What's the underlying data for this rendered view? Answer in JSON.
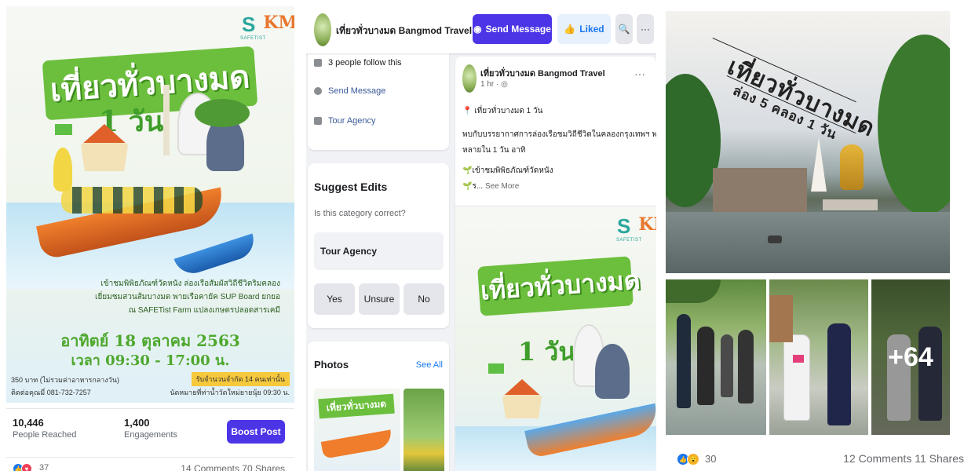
{
  "panel1": {
    "poster": {
      "title": "เที่ยวทั่วบางมด",
      "one_day": "1 วัน",
      "logo_left": "S",
      "logo_caption": "SAFETIST",
      "logo_right": "KM",
      "lines": [
        "เข้าชมพิพิธภัณฑ์วัดหนัง ล่องเรือสัมผัสวิถีชีวิตริมคลอง",
        "เยี่ยมชมสวนส้มบางมด พายเรือคายัค SUP Board ยกยอ",
        "ณ SAFETist Farm แปลงเกษตรปลอดสารเคมี"
      ],
      "date": "อาทิตย์ 18 ตุลาคม 2563",
      "time": "เวลา 09:30 - 17:00 น.",
      "price": "350 บาท (ไม่รวมค่าอาหารกลางวัน)",
      "contact": "ติดต่อคุณมี่ 081-732-7257",
      "limit": "รับจำนวนจำกัด 14 คนเท่านั้น",
      "meet": "นัดหมายที่ท่าน้ำวัดใหม่ยายนุ้ย 09:30 น."
    },
    "stats": {
      "reached_value": "10,446",
      "reached_label": "People Reached",
      "engagements_value": "1,400",
      "engagements_label": "Engagements",
      "boost_label": "Boost Post"
    },
    "reactions": {
      "count": "37",
      "comments_shares": "14 Comments  70 Shares"
    }
  },
  "panel2": {
    "header": {
      "page_name": "เที่ยวทั่วบางมด Bangmod Travel",
      "send_label": "Send Message",
      "liked_label": "Liked",
      "search_icon": "🔍",
      "more_icon": "···"
    },
    "about": {
      "followers": "3 people follow this",
      "send_message": "Send Message",
      "category": "Tour Agency"
    },
    "suggest": {
      "title": "Suggest Edits",
      "question": "Is this category correct?",
      "category": "Tour Agency",
      "yes": "Yes",
      "unsure": "Unsure",
      "no": "No"
    },
    "photos": {
      "title": "Photos",
      "see_all": "See All",
      "thumb_title": "เที่ยวทั่วบางมด"
    },
    "post": {
      "author": "เที่ยวทั่วบางมด Bangmod Travel",
      "time": "1 hr · ◎",
      "line1": "เที่ยวทั่วบางมด 1 วัน",
      "line2": "พบกับบรรยากาศการล่องเรือชมวิถีชีวิตในคลองกรุงเทพฯ พร้อมกิจกรรมหลาก",
      "line3": "หลายใน 1 วัน อาทิ",
      "line4": "เข้าชมพิพิธภัณฑ์วัดหนัง",
      "line5_prefix": "ร...",
      "see_more": "See More",
      "poster_title": "เที่ยวทั่วบางมด",
      "poster_one_day": "1 วัน",
      "logo_left": "S",
      "logo_caption": "SAFETIST",
      "logo_right": "KM"
    }
  },
  "panel3": {
    "cover_line1": "เที่ยวทั่วบางมด",
    "cover_line2": "ล่อง 5 คลอง 1 วัน",
    "more_photos": "+64",
    "reactions": {
      "count": "30",
      "comments_shares": "12 Comments  11 Shares"
    }
  }
}
